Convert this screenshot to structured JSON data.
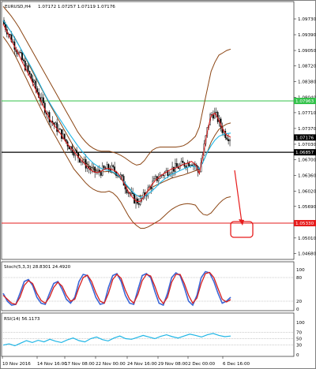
{
  "colors": {
    "price_candles": "#000000",
    "ma_fast": "#d61f1f",
    "ma_slow": "#1fb6e6",
    "bollinger": "#8b4513",
    "support_resistance": "#000000",
    "resistance_top": "#33c24a",
    "target_red": "#e61c1c",
    "stoch_main": "#3b66d6",
    "stoch_signal": "#d61f1f",
    "rsi": "#1fb6e6"
  },
  "main_panel": {
    "header": {
      "symbol": "EURUSD,H4",
      "ohlc": "1.07172 1.07257 1.07119 1.07176"
    },
    "levels": [
      {
        "value": 1.07963,
        "label": "1.07963",
        "style": "line",
        "color": "#33c24a"
      },
      {
        "value": 1.06857,
        "label": "1.06857",
        "style": "line",
        "color": "#000000"
      },
      {
        "value": 1.0533,
        "label": "1.05330",
        "style": "line",
        "color": "#e61c1c"
      },
      {
        "value": 1.07176,
        "label": "1.07176",
        "style": "tag",
        "color": "#000000"
      }
    ],
    "y_axis_ticks": [
      "1.09730",
      "1.09390",
      "1.09050",
      "1.08720",
      "1.08380",
      "1.08040",
      "1.07710",
      "1.07370",
      "1.07030",
      "1.06700",
      "1.06360",
      "1.06020",
      "1.05690",
      "1.05350",
      "1.05010",
      "1.04680"
    ]
  },
  "stoch_panel": {
    "title": "Stoch(5,3,3) 28.8301 24.4920",
    "y_ticks": [
      "100",
      "80",
      "20",
      "0"
    ]
  },
  "rsi_panel": {
    "title": "RSI(14) 56.1173",
    "y_ticks": [
      "100",
      "70",
      "50",
      "30",
      "0"
    ]
  },
  "x_axis_ticks": [
    "10 Nov 2016",
    "14 Nov 16:00",
    "17 Nov 08:00",
    "22 Nov 00:00",
    "24 Nov 16:00",
    "29 Nov 08:00",
    "2 Dec 00:00",
    "6 Dec 16:00"
  ],
  "chart_data": [
    {
      "type": "line",
      "title": "EURUSD,H4",
      "series": [
        {
          "name": "",
          "values": [
            1.0962,
            1.0945,
            1.0928,
            1.0912,
            1.0896,
            1.0878,
            1.0862,
            1.0845,
            1.0826,
            1.0808,
            1.0789,
            1.0772,
            1.0755,
            1.0744,
            1.0733,
            1.0721,
            1.0708,
            1.0697,
            1.0688,
            1.0677,
            1.0668,
            1.0659,
            1.065,
            1.0644,
            1.0642,
            1.0645,
            1.065,
            1.0651,
            1.0648,
            1.0643,
            1.0632,
            1.0616,
            1.06,
            1.0588,
            1.058,
            1.058,
            1.0592,
            1.0605,
            1.0617,
            1.0627,
            1.0634,
            1.064,
            1.0645,
            1.065,
            1.0652,
            1.0655,
            1.066,
            1.0662,
            1.0666,
            1.066,
            1.064,
            1.068,
            1.0728,
            1.0765,
            1.077,
            1.0755,
            1.0735,
            1.0723,
            1.0718
          ]
        },
        {
          "name": "",
          "values": [
            1.097,
            1.0958,
            1.0945,
            1.093,
            1.0916,
            1.0901,
            1.0886,
            1.0871,
            1.0855,
            1.0838,
            1.0821,
            1.0805,
            1.079,
            1.0776,
            1.0763,
            1.075,
            1.0737,
            1.0724,
            1.0712,
            1.07,
            1.0689,
            1.0679,
            1.067,
            1.0662,
            1.0656,
            1.0651,
            1.0648,
            1.0646,
            1.0643,
            1.0638,
            1.063,
            1.062,
            1.061,
            1.06,
            1.0593,
            1.0589,
            1.059,
            1.0596,
            1.0603,
            1.0611,
            1.062,
            1.0627,
            1.0633,
            1.0638,
            1.0642,
            1.0646,
            1.065,
            1.0653,
            1.0656,
            1.0655,
            1.065,
            1.0665,
            1.0685,
            1.07,
            1.0712,
            1.072,
            1.0724,
            1.0726,
            1.0727
          ]
        },
        {
          "name": "",
          "values": [
            1.1,
            1.099,
            1.098,
            1.0968,
            1.0955,
            1.094,
            1.0925,
            1.091,
            1.0895,
            1.088,
            1.0865,
            1.085,
            1.0835,
            1.082,
            1.0805,
            1.079,
            1.0775,
            1.076,
            1.0745,
            1.073,
            1.0718,
            1.0708,
            1.07,
            1.0694,
            1.069,
            1.0688,
            1.0688,
            1.0688,
            1.0686,
            1.0683,
            1.0679,
            1.0674,
            1.0668,
            1.0662,
            1.0658,
            1.066,
            1.0668,
            1.068,
            1.069,
            1.0695,
            1.0697,
            1.0697,
            1.0697,
            1.0697,
            1.0697,
            1.0698,
            1.07,
            1.0705,
            1.0712,
            1.072,
            1.074,
            1.078,
            1.082,
            1.086,
            1.088,
            1.0895,
            1.09,
            1.0905,
            1.0908
          ]
        },
        {
          "name": "",
          "values": [
            1.0935,
            1.0923,
            1.091,
            1.0895,
            1.0878,
            1.086,
            1.0843,
            1.0825,
            1.0808,
            1.079,
            1.0773,
            1.0757,
            1.074,
            1.0725,
            1.071,
            1.0695,
            1.068,
            1.0665,
            1.065,
            1.064,
            1.063,
            1.062,
            1.0612,
            1.0606,
            1.0602,
            1.06,
            1.06,
            1.0602,
            1.0598,
            1.059,
            1.0578,
            1.0563,
            1.0548,
            1.0536,
            1.0528,
            1.0522,
            1.0522,
            1.0525,
            1.053,
            1.0535,
            1.054,
            1.0548,
            1.0556,
            1.0563,
            1.0568,
            1.0572,
            1.0574,
            1.0575,
            1.0574,
            1.0572,
            1.056,
            1.0552,
            1.055,
            1.0555,
            1.0565,
            1.0575,
            1.0583,
            1.0588,
            1.059
          ]
        }
      ]
    },
    {
      "type": "line",
      "title": "Stoch(5,3,3) 28.8301 24.4920",
      "ylim": [
        0,
        100
      ],
      "series": [
        {
          "name": "",
          "values": [
            40,
            20,
            10,
            12,
            40,
            70,
            75,
            60,
            30,
            15,
            12,
            40,
            65,
            70,
            50,
            25,
            15,
            30,
            70,
            88,
            85,
            60,
            30,
            12,
            15,
            55,
            85,
            90,
            70,
            35,
            15,
            12,
            50,
            85,
            90,
            80,
            45,
            15,
            10,
            40,
            80,
            92,
            85,
            55,
            20,
            10,
            35,
            80,
            95,
            92,
            70,
            40,
            15,
            20,
            30
          ]
        },
        {
          "name": "",
          "values": [
            35,
            25,
            15,
            12,
            30,
            60,
            72,
            65,
            40,
            22,
            15,
            30,
            55,
            68,
            58,
            35,
            20,
            25,
            55,
            80,
            86,
            70,
            42,
            20,
            15,
            40,
            75,
            88,
            78,
            48,
            25,
            15,
            38,
            72,
            88,
            84,
            58,
            28,
            14,
            30,
            68,
            88,
            88,
            65,
            35,
            15,
            28,
            65,
            90,
            93,
            80,
            52,
            25,
            18,
            24
          ]
        }
      ]
    },
    {
      "type": "line",
      "title": "RSI(14) 56.1173",
      "ylim": [
        0,
        100
      ],
      "series": [
        {
          "name": "",
          "values": [
            30,
            34,
            28,
            36,
            44,
            38,
            45,
            40,
            48,
            42,
            38,
            46,
            52,
            44,
            40,
            50,
            55,
            47,
            43,
            52,
            58,
            50,
            48,
            54,
            60,
            55,
            50,
            57,
            62,
            56,
            52,
            58,
            64,
            60,
            55,
            62,
            66,
            60,
            56,
            58
          ]
        }
      ]
    }
  ]
}
